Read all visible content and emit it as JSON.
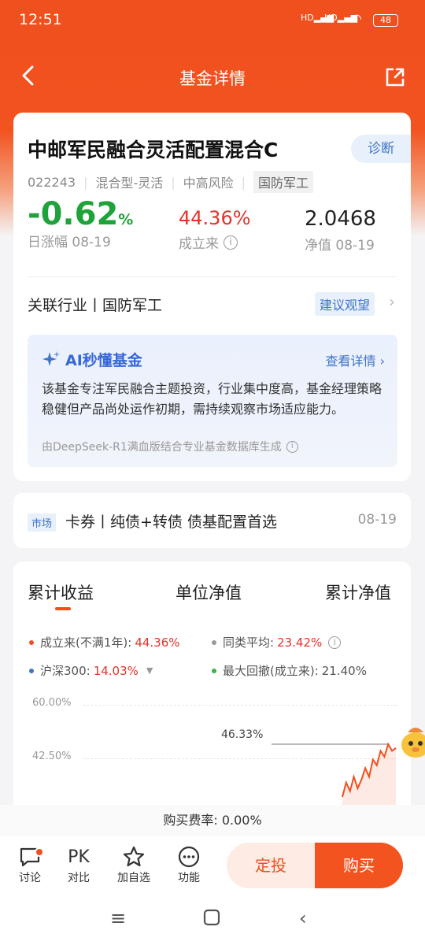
{
  "status_bar": {
    "time": "12:51",
    "signal1": "HD",
    "signal2": "HD",
    "battery": "48"
  },
  "nav": {
    "title": "基金详情"
  },
  "fund": {
    "name": "中邮军民融合灵活配置混合C",
    "diagnose_label": "诊断",
    "code": "022243",
    "type": "混合型-灵活",
    "risk": "中高风险",
    "theme_tag": "国防军工",
    "daily_change": "-0.62",
    "daily_change_unit": "%",
    "daily_change_label": "日涨幅 08-19",
    "since_inception": "44.36%",
    "since_inception_label": "成立来",
    "nav_value": "2.0468",
    "nav_label": "净值 08-19",
    "industry": "关联行业丨国防军工",
    "advice": "建议观望"
  },
  "ai": {
    "title": "AI秒懂基金",
    "more": "查看详情",
    "text": "该基金专注军民融合主题投资，行业集中度高，基金经理策略稳健但产品尚处运作初期，需持续观察市场适应能力。",
    "source": "由DeepSeek-R1满血版结合专业基金数据库生成"
  },
  "market": {
    "badge": "市场",
    "text": "卡券丨纯债+转债 债基配置首选",
    "date": "08-19"
  },
  "chart_tabs": [
    "累计收益",
    "单位净值",
    "累计净值"
  ],
  "legend": {
    "since_inception_label": "成立来(不满1年):",
    "since_inception_value": "44.36%",
    "peer_avg_label": "同类平均:",
    "peer_avg_value": "23.42%",
    "hs300_label": "沪深300:",
    "hs300_value": "14.03%",
    "max_drawdown_label": "最大回撤(成立来):",
    "max_drawdown_value": "21.40%"
  },
  "chart_data": {
    "type": "line",
    "yticks": [
      "60.00%",
      "42.50%"
    ],
    "ylim_visible": [
      25,
      60
    ],
    "series": [
      {
        "name": "成立来",
        "color": "#f04f1e",
        "values": [
          28,
          33,
          30,
          35,
          31,
          34,
          38,
          35,
          41,
          39,
          44,
          42,
          46.33,
          44,
          45
        ]
      }
    ],
    "annotation": "46.33%"
  },
  "fee": "购买费率:  0.00%",
  "bottom_bar": {
    "discuss": "讨论",
    "pk_icon_text": "PK",
    "compare": "对比",
    "watch": "加自选",
    "more": "功能",
    "dingtou": "定投",
    "buy": "购买"
  },
  "colors": {
    "brand": "#f04f1e",
    "green": "#1fa23a",
    "red": "#e3332a",
    "blue": "#3f74c7"
  }
}
